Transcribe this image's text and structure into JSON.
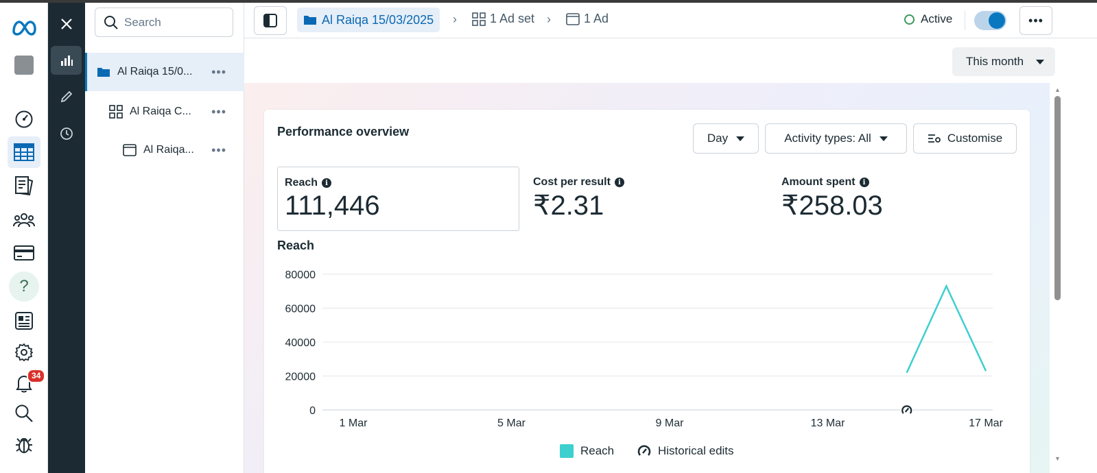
{
  "tree": {
    "search_placeholder": "Search",
    "items": [
      {
        "label": "Al Raiqa 15/0...",
        "more": "•••"
      },
      {
        "label": "Al Raiqa C...",
        "more": "•••"
      },
      {
        "label": "Al Raiqa...",
        "more": "•••"
      }
    ]
  },
  "nav": {
    "notification_count": "34",
    "help_glyph": "?"
  },
  "header": {
    "campaign": "Al Raiqa 15/03/2025",
    "adset": "1 Ad set",
    "ad": "1 Ad",
    "status": "Active",
    "more": "•••",
    "date_range": "This month"
  },
  "overview": {
    "title": "Performance overview",
    "day_dropdown": "Day",
    "activity_dropdown": "Activity types: All",
    "customise": "Customise",
    "metrics": [
      {
        "label": "Reach",
        "value": "111,446"
      },
      {
        "label": "Cost per result",
        "value": "₹2.31"
      },
      {
        "label": "Amount spent",
        "value": "₹258.03"
      }
    ],
    "chart_title": "Reach",
    "legend_reach": "Reach",
    "legend_edits": "Historical edits"
  },
  "colors": {
    "accent": "#0a78be",
    "series": "#3ecfcf",
    "status_green": "#3a9a5c"
  },
  "chart_data": {
    "type": "line",
    "title": "Reach",
    "x": [
      "1 Mar",
      "2 Mar",
      "3 Mar",
      "4 Mar",
      "5 Mar",
      "6 Mar",
      "7 Mar",
      "8 Mar",
      "9 Mar",
      "10 Mar",
      "11 Mar",
      "12 Mar",
      "13 Mar",
      "14 Mar",
      "15 Mar",
      "16 Mar",
      "17 Mar"
    ],
    "x_ticks": [
      "1 Mar",
      "5 Mar",
      "9 Mar",
      "13 Mar",
      "17 Mar"
    ],
    "y_ticks": [
      0,
      20000,
      40000,
      60000,
      80000
    ],
    "ylim": [
      0,
      80000
    ],
    "series": [
      {
        "name": "Reach",
        "values": [
          null,
          null,
          null,
          null,
          null,
          null,
          null,
          null,
          null,
          null,
          null,
          null,
          null,
          null,
          22000,
          73000,
          23000
        ]
      }
    ],
    "historical_edit_at": "15 Mar",
    "grid": true,
    "legend": "bottom"
  }
}
